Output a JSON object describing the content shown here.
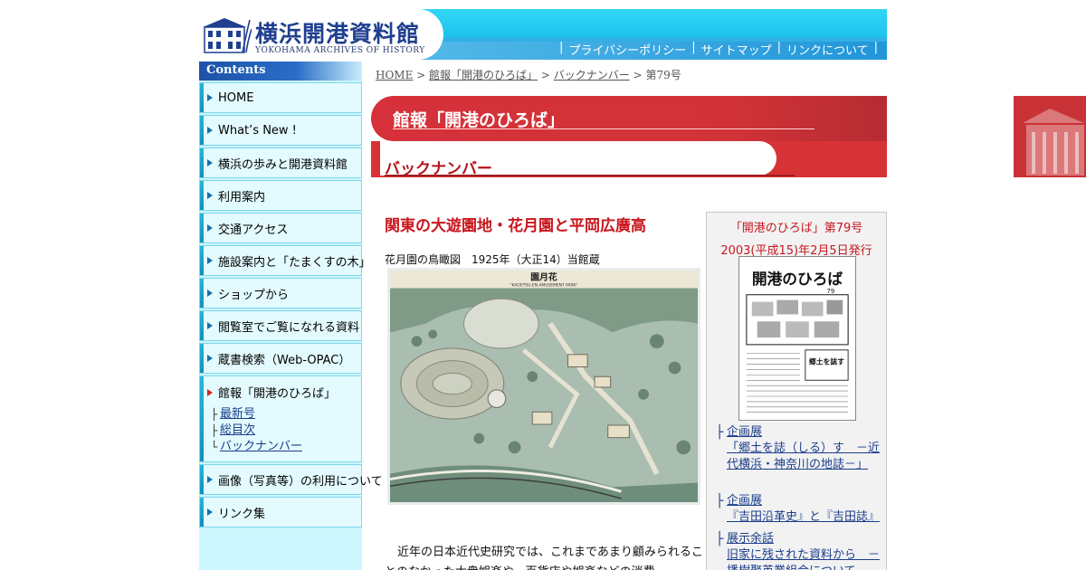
{
  "header": {
    "title": "横浜開港資料館",
    "subtitle": "YOKOHAMA ARCHIVES OF HISTORY",
    "util_links": [
      "プライバシーポリシー",
      "サイトマップ",
      "リンクについて"
    ],
    "colors": {
      "header_cyan": "#1bc3ec",
      "header_blue": "#2196d9",
      "brand_navy": "#1f3f8f"
    }
  },
  "sidebar": {
    "heading": "Contents",
    "items": [
      {
        "label": "HOME"
      },
      {
        "label": "What’s New !"
      },
      {
        "label": "横浜の歩みと開港資料館"
      },
      {
        "label": "利用案内"
      },
      {
        "label": "交通アクセス"
      },
      {
        "label": "施設案内と「たまくすの木」"
      },
      {
        "label": "ショップから"
      },
      {
        "label": "閲覧室でご覧になれる資料"
      },
      {
        "label": "蔵書検索（Web-OPAC）"
      },
      {
        "label": "館報「開港のひろば」"
      },
      {
        "label": "画像（写真等）の利用について"
      },
      {
        "label": "リンク集"
      }
    ],
    "newsletter_sub": [
      {
        "mark": "├",
        "label": "最新号"
      },
      {
        "mark": "├",
        "label": "総目次"
      },
      {
        "mark": "└",
        "label": "バックナンバー"
      }
    ]
  },
  "breadcrumb": {
    "home": "HOME",
    "sep": " > ",
    "level1": "館報「開港のひろば」",
    "level2": "バックナンバー",
    "current": "第79号"
  },
  "banner": {
    "section": "館報「開港のひろば」",
    "subsection": "バックナンバー",
    "accent": "#d6313a"
  },
  "article": {
    "title": "関東の大遊園地・花月園と平岡広廣高",
    "caption": "花月園の鳥瞰図　1925年（大正14）当館蔵",
    "map_title": "園月花",
    "map_subtitle": "\"KAGETSU-EN AMUSEMENT PARK\"",
    "body": "近年の日本近代史研究では、これまであまり顧みられることのなかった大衆娯楽や、百貨店や娯楽などの消費"
  },
  "issue": {
    "number": "「開港のひろば」第79号",
    "date": "2003(平成15)年2月5日発行",
    "cover_title": "開港のひろば",
    "cover_no": "79",
    "cover_heading": "郷土を誌す",
    "topics": [
      {
        "mark": "├",
        "title": "企画展",
        "desc": "「郷土を誌（しる）す　－近代横浜・神奈川の地誌－」"
      },
      {
        "mark": "├",
        "title": "企画展",
        "desc": "『吉田沿革史』と『吉田誌』"
      },
      {
        "mark": "├",
        "title": "展示余話",
        "desc": "旧家に残された資料から　－播樹聚英業組合について"
      }
    ]
  }
}
